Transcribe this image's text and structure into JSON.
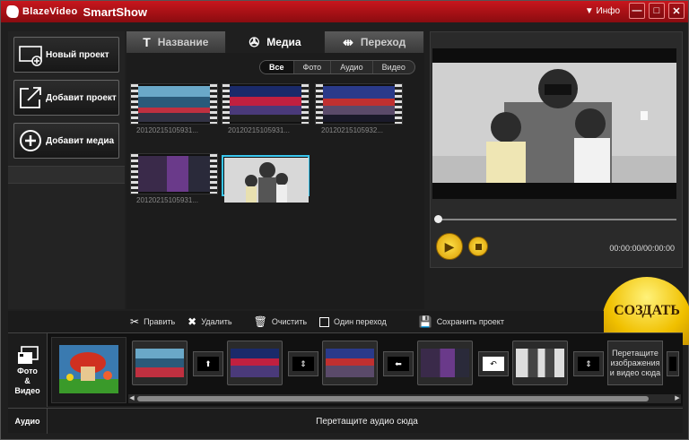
{
  "titlebar": {
    "brand": "BlazeVideo",
    "product": "SmartShow",
    "info_label": "Инфо",
    "minimize": "—",
    "maximize": "□",
    "close": "✕"
  },
  "sidebar": {
    "buttons": [
      {
        "label": "Новый проект",
        "icon": "new-project-icon"
      },
      {
        "label": "Добавит проект",
        "icon": "open-project-icon"
      },
      {
        "label": "Добавит медиа",
        "icon": "add-media-icon"
      }
    ]
  },
  "tabs": [
    {
      "label": "Название",
      "icon": "T",
      "active": false
    },
    {
      "label": "Медиа",
      "icon": "film-reel-icon",
      "active": true
    },
    {
      "label": "Переход",
      "icon": "transition-icon",
      "active": false
    }
  ],
  "filters": [
    "Все",
    "Фото",
    "Аудио",
    "Видео"
  ],
  "media": [
    {
      "name": "20120215105931..."
    },
    {
      "name": "20120215105931..."
    },
    {
      "name": "20120215105932..."
    },
    {
      "name": "20120215105931..."
    },
    {
      "name": ""
    }
  ],
  "player": {
    "timecode": "00:00:00/00:00:00",
    "progress": 0
  },
  "create_button": "СОЗДАТЬ",
  "actions": [
    {
      "label": "Править",
      "icon": "scissors-icon"
    },
    {
      "label": "Удалить",
      "icon": "delete-icon"
    },
    {
      "label": "Очистить",
      "icon": "trash-icon"
    },
    {
      "label": "Один переход",
      "icon": "checkbox-icon"
    },
    {
      "label": "Сохранить проект",
      "icon": "save-icon"
    }
  ],
  "timeline": {
    "label": "Фото & Видео",
    "label_lines": [
      "Фото",
      "&",
      "Видео"
    ],
    "drop_text": "Перетащите изображения и видео сюда"
  },
  "audio": {
    "label": "Аудио",
    "drop_text": "Перетащите аудио сюда"
  },
  "colors": {
    "title_red": "#c8161d",
    "selection_blue": "#3ac7f0",
    "create_yellow": "#f0c000"
  }
}
